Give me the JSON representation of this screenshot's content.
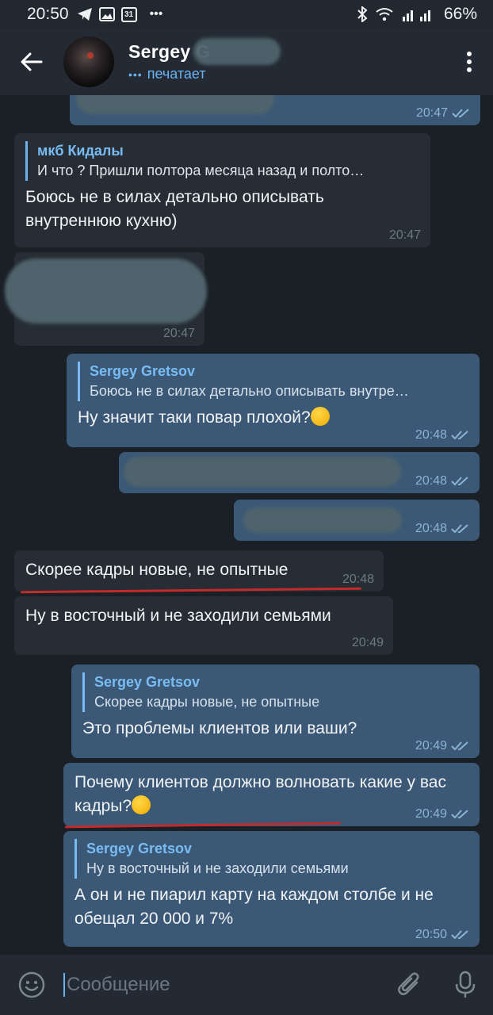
{
  "status_bar": {
    "time": "20:50",
    "battery": "66%",
    "icons": [
      "telegram-icon",
      "gallery-icon",
      "calendar-icon",
      "more-dots-icon",
      "bluetooth-icon",
      "wifi-icon",
      "signal-icon"
    ],
    "calendar_day": "31",
    "more": "•••"
  },
  "header": {
    "contact_name": "Sergey G",
    "status": "печатает",
    "typing_dots": "•••"
  },
  "messages": [
    {
      "dir": "out",
      "time": "20:47",
      "redacted": true
    },
    {
      "dir": "in",
      "reply_name": "мкб Кидалы",
      "reply_text": "И что ? Пришли полтора месяца назад и полто…",
      "text": "Боюсь не в силах детально описывать внутреннюю кухню)",
      "time": "20:47"
    },
    {
      "dir": "in",
      "time": "20:47",
      "redacted": true
    },
    {
      "dir": "out",
      "reply_name": "Sergey Gretsov",
      "reply_text": "Боюсь не в силах детально описывать внутре…",
      "text": "Ну значит таки повар плохой?",
      "time": "20:48"
    },
    {
      "dir": "out",
      "time": "20:48",
      "redacted": true
    },
    {
      "dir": "out",
      "time": "20:48",
      "redacted": true
    },
    {
      "dir": "in",
      "text": "Скорее кадры новые, не опытные",
      "time": "20:48"
    },
    {
      "dir": "in",
      "text": "Ну в восточный и не заходили семьями",
      "time": "20:49"
    },
    {
      "dir": "out",
      "reply_name": "Sergey Gretsov",
      "reply_text": "Скорее кадры новые, не опытные",
      "text": "Это проблемы клиентов или ваши?",
      "time": "20:49"
    },
    {
      "dir": "out",
      "text": "Почему клиентов должно волновать какие у вас кадры?",
      "time": "20:49"
    },
    {
      "dir": "out",
      "reply_name": "Sergey Gretsov",
      "reply_text": "Ну в восточный и не заходили семьями",
      "text": "А он и не пиарил карту на каждом столбе и не обещал 20 000 и 7%",
      "time": "20:50"
    }
  ],
  "composer": {
    "placeholder": "Сообщение"
  },
  "colors": {
    "background": "#1b2027",
    "incoming_bubble": "#262d35",
    "outgoing_bubble": "#3b5976",
    "accent": "#6ab3f3",
    "annotation_red": "#c42a2a"
  }
}
